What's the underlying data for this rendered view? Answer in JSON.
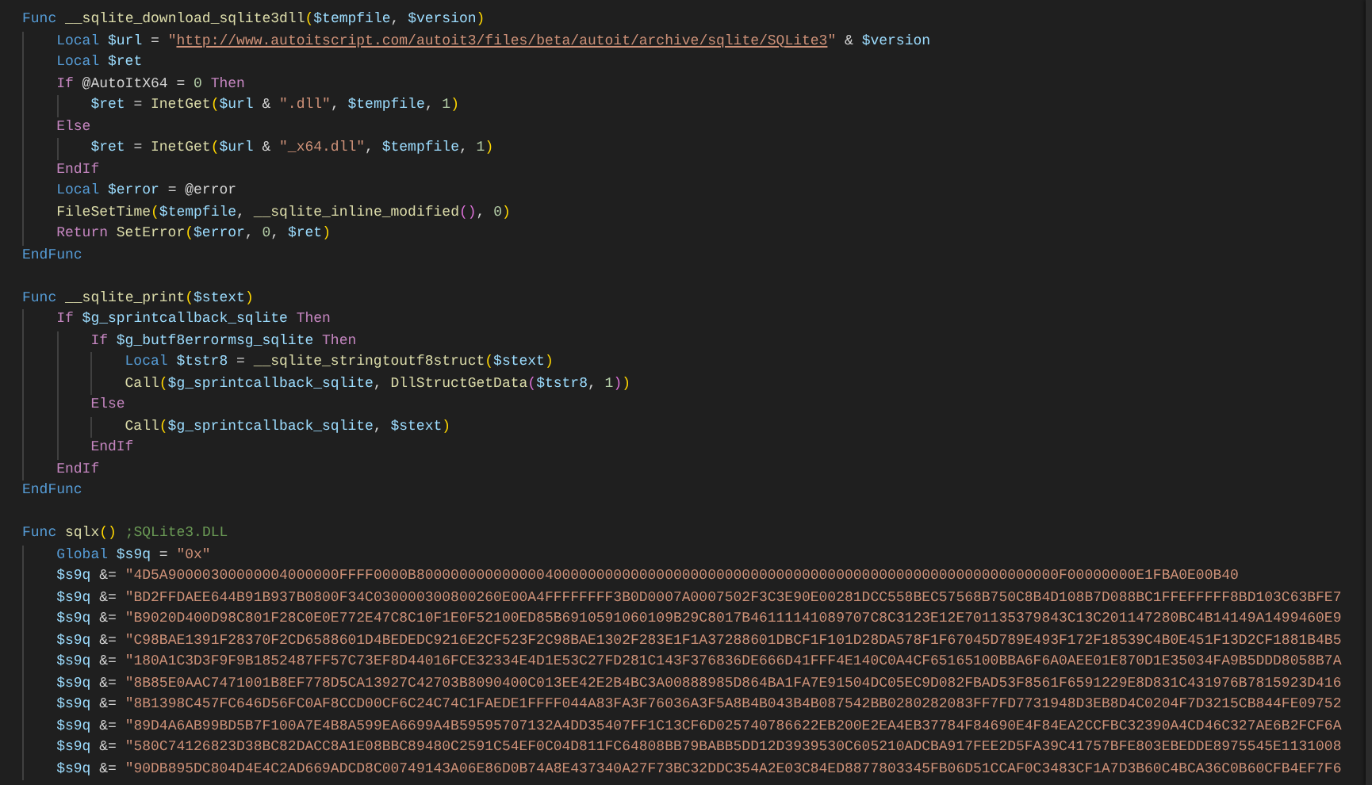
{
  "editor": {
    "lines": [
      {
        "kind": "code",
        "tokens": [
          {
            "kind": "keyword",
            "text": "Func"
          },
          {
            "kind": "function",
            "text": " __sqlite_download_sqlite3dll"
          },
          {
            "kind": "open",
            "text": "("
          },
          {
            "kind": "variable",
            "text": "$tempfile"
          },
          {
            "kind": "operator",
            "text": ", "
          },
          {
            "kind": "variable",
            "text": "$version"
          },
          {
            "kind": "close",
            "text": ")"
          }
        ],
        "children": [
          {
            "tokens": [
              {
                "kind": "keyword",
                "text": "Local"
              },
              {
                "kind": "variable",
                "text": " $url"
              },
              {
                "kind": "operator",
                "text": " = "
              },
              {
                "kind": "string",
                "text": "\""
              },
              {
                "kind": "link",
                "text": "http://www.autoitscript.com/autoit3/files/beta/autoit/archive/sqlite/SQLite3"
              },
              {
                "kind": "string",
                "text": "\""
              },
              {
                "kind": "operator",
                "text": " & "
              },
              {
                "kind": "variable",
                "text": "$version"
              }
            ]
          },
          {
            "tokens": [
              {
                "kind": "keyword",
                "text": "Local"
              },
              {
                "kind": "variable",
                "text": " $ret"
              }
            ]
          },
          {
            "tokens": [
              {
                "kind": "control",
                "text": "If"
              },
              {
                "kind": "macro",
                "text": " @AutoItX64"
              },
              {
                "kind": "operator",
                "text": " = "
              },
              {
                "kind": "number",
                "text": "0"
              },
              {
                "kind": "control",
                "text": " Then"
              }
            ],
            "children": [
              {
                "tokens": [
                  {
                    "kind": "variable",
                    "text": "$ret"
                  },
                  {
                    "kind": "operator",
                    "text": " = "
                  },
                  {
                    "kind": "function",
                    "text": "InetGet"
                  },
                  {
                    "kind": "open",
                    "text": "("
                  },
                  {
                    "kind": "variable",
                    "text": "$url"
                  },
                  {
                    "kind": "operator",
                    "text": " & "
                  },
                  {
                    "kind": "string",
                    "text": "\".dll\""
                  },
                  {
                    "kind": "operator",
                    "text": ", "
                  },
                  {
                    "kind": "variable",
                    "text": "$tempfile"
                  },
                  {
                    "kind": "operator",
                    "text": ", "
                  },
                  {
                    "kind": "number",
                    "text": "1"
                  },
                  {
                    "kind": "close",
                    "text": ")"
                  }
                ]
              }
            ]
          },
          {
            "tokens": [
              {
                "kind": "control",
                "text": "Else"
              }
            ],
            "children": [
              {
                "tokens": [
                  {
                    "kind": "variable",
                    "text": "$ret"
                  },
                  {
                    "kind": "operator",
                    "text": " = "
                  },
                  {
                    "kind": "function",
                    "text": "InetGet"
                  },
                  {
                    "kind": "open",
                    "text": "("
                  },
                  {
                    "kind": "variable",
                    "text": "$url"
                  },
                  {
                    "kind": "operator",
                    "text": " & "
                  },
                  {
                    "kind": "string",
                    "text": "\"_x64.dll\""
                  },
                  {
                    "kind": "operator",
                    "text": ", "
                  },
                  {
                    "kind": "variable",
                    "text": "$tempfile"
                  },
                  {
                    "kind": "operator",
                    "text": ", "
                  },
                  {
                    "kind": "number",
                    "text": "1"
                  },
                  {
                    "kind": "close",
                    "text": ")"
                  }
                ]
              }
            ]
          },
          {
            "tokens": [
              {
                "kind": "control",
                "text": "EndIf"
              }
            ]
          },
          {
            "tokens": [
              {
                "kind": "keyword",
                "text": "Local"
              },
              {
                "kind": "variable",
                "text": " $error"
              },
              {
                "kind": "operator",
                "text": " = "
              },
              {
                "kind": "macro",
                "text": "@error"
              }
            ]
          },
          {
            "tokens": [
              {
                "kind": "function",
                "text": "FileSetTime"
              },
              {
                "kind": "open",
                "text": "("
              },
              {
                "kind": "variable",
                "text": "$tempfile"
              },
              {
                "kind": "operator",
                "text": ", "
              },
              {
                "kind": "function",
                "text": "__sqlite_inline_modified"
              },
              {
                "kind": "open",
                "text": "("
              },
              {
                "kind": "close",
                "text": ")"
              },
              {
                "kind": "operator",
                "text": ", "
              },
              {
                "kind": "number",
                "text": "0"
              },
              {
                "kind": "close",
                "text": ")"
              }
            ]
          },
          {
            "tokens": [
              {
                "kind": "control",
                "text": "Return"
              },
              {
                "kind": "function",
                "text": " SetError"
              },
              {
                "kind": "open",
                "text": "("
              },
              {
                "kind": "variable",
                "text": "$error"
              },
              {
                "kind": "operator",
                "text": ", "
              },
              {
                "kind": "number",
                "text": "0"
              },
              {
                "kind": "operator",
                "text": ", "
              },
              {
                "kind": "variable",
                "text": "$ret"
              },
              {
                "kind": "close",
                "text": ")"
              }
            ]
          }
        ]
      },
      {
        "kind": "code",
        "tokens": [
          {
            "kind": "keyword",
            "text": "EndFunc"
          }
        ]
      },
      {
        "kind": "blank"
      },
      {
        "kind": "code",
        "tokens": [
          {
            "kind": "keyword",
            "text": "Func"
          },
          {
            "kind": "function",
            "text": " __sqlite_print"
          },
          {
            "kind": "open",
            "text": "("
          },
          {
            "kind": "variable",
            "text": "$stext"
          },
          {
            "kind": "close",
            "text": ")"
          }
        ],
        "children": [
          {
            "tokens": [
              {
                "kind": "control",
                "text": "If"
              },
              {
                "kind": "variable",
                "text": " $g_sprintcallback_sqlite"
              },
              {
                "kind": "control",
                "text": " Then"
              }
            ],
            "children": [
              {
                "tokens": [
                  {
                    "kind": "control",
                    "text": "If"
                  },
                  {
                    "kind": "variable",
                    "text": " $g_butf8errormsg_sqlite"
                  },
                  {
                    "kind": "control",
                    "text": " Then"
                  }
                ],
                "children": [
                  {
                    "tokens": [
                      {
                        "kind": "keyword",
                        "text": "Local"
                      },
                      {
                        "kind": "variable",
                        "text": " $tstr8"
                      },
                      {
                        "kind": "operator",
                        "text": " = "
                      },
                      {
                        "kind": "function",
                        "text": "__sqlite_stringtoutf8struct"
                      },
                      {
                        "kind": "open",
                        "text": "("
                      },
                      {
                        "kind": "variable",
                        "text": "$stext"
                      },
                      {
                        "kind": "close",
                        "text": ")"
                      }
                    ]
                  },
                  {
                    "tokens": [
                      {
                        "kind": "function",
                        "text": "Call"
                      },
                      {
                        "kind": "open",
                        "text": "("
                      },
                      {
                        "kind": "variable",
                        "text": "$g_sprintcallback_sqlite"
                      },
                      {
                        "kind": "operator",
                        "text": ", "
                      },
                      {
                        "kind": "function",
                        "text": "DllStructGetData"
                      },
                      {
                        "kind": "open",
                        "text": "("
                      },
                      {
                        "kind": "variable",
                        "text": "$tstr8"
                      },
                      {
                        "kind": "operator",
                        "text": ", "
                      },
                      {
                        "kind": "number",
                        "text": "1"
                      },
                      {
                        "kind": "close",
                        "text": ")"
                      },
                      {
                        "kind": "close",
                        "text": ")"
                      }
                    ]
                  }
                ]
              },
              {
                "tokens": [
                  {
                    "kind": "control",
                    "text": "Else"
                  }
                ],
                "children": [
                  {
                    "tokens": [
                      {
                        "kind": "function",
                        "text": "Call"
                      },
                      {
                        "kind": "open",
                        "text": "("
                      },
                      {
                        "kind": "variable",
                        "text": "$g_sprintcallback_sqlite"
                      },
                      {
                        "kind": "operator",
                        "text": ", "
                      },
                      {
                        "kind": "variable",
                        "text": "$stext"
                      },
                      {
                        "kind": "close",
                        "text": ")"
                      }
                    ]
                  }
                ]
              },
              {
                "tokens": [
                  {
                    "kind": "control",
                    "text": "EndIf"
                  }
                ]
              }
            ]
          },
          {
            "tokens": [
              {
                "kind": "control",
                "text": "EndIf"
              }
            ]
          }
        ]
      },
      {
        "kind": "code",
        "tokens": [
          {
            "kind": "keyword",
            "text": "EndFunc"
          }
        ]
      },
      {
        "kind": "blank"
      },
      {
        "kind": "code",
        "tokens": [
          {
            "kind": "keyword",
            "text": "Func"
          },
          {
            "kind": "function",
            "text": " sqlx"
          },
          {
            "kind": "open",
            "text": "("
          },
          {
            "kind": "close",
            "text": ")"
          },
          {
            "kind": "comment",
            "text": " ;SQLite3.DLL"
          }
        ],
        "children": [
          {
            "tokens": [
              {
                "kind": "keyword",
                "text": "Global"
              },
              {
                "kind": "variable",
                "text": " $s9q"
              },
              {
                "kind": "operator",
                "text": " = "
              },
              {
                "kind": "string",
                "text": "\"0x\""
              }
            ]
          },
          {
            "tokens": [
              {
                "kind": "variable",
                "text": "$s9q"
              },
              {
                "kind": "operator",
                "text": " &= "
              },
              {
                "kind": "string",
                "text": "\"4D5A90000300000004000000FFFF0000B800000000000000400000000000000000000000000000000000000000000000000000000000F00000000E1FBA0E00B40"
              }
            ]
          },
          {
            "tokens": [
              {
                "kind": "variable",
                "text": "$s9q"
              },
              {
                "kind": "operator",
                "text": " &= "
              },
              {
                "kind": "string",
                "text": "\"BD2FFDAEE644B91B937B0800F34C030000300800260E00A4FFFFFFFF3B0D0007A0007502F3C3E90E00281DCC558BEC57568B750C8B4D108B7D088BC1FFEFFFFF8BD103C63BFE7"
              }
            ]
          },
          {
            "tokens": [
              {
                "kind": "variable",
                "text": "$s9q"
              },
              {
                "kind": "operator",
                "text": " &= "
              },
              {
                "kind": "string",
                "text": "\"B9020D400D98C801F28C0E0E772E47C8C10F1E0F52100ED85B6910591060109B29C8017B46111141089707C8C3123E12E701135379843C13C201147280BC4B14149A1499460E9"
              }
            ]
          },
          {
            "tokens": [
              {
                "kind": "variable",
                "text": "$s9q"
              },
              {
                "kind": "operator",
                "text": " &= "
              },
              {
                "kind": "string",
                "text": "\"C98BAE1391F28370F2CD6588601D4BEDEDC9216E2CF523F2C98BAE1302F283E1F1A37288601DBCF1F101D28DA578F1F67045D789E493F172F18539C4B0E451F13D2CF1881B4B5"
              }
            ]
          },
          {
            "tokens": [
              {
                "kind": "variable",
                "text": "$s9q"
              },
              {
                "kind": "operator",
                "text": " &= "
              },
              {
                "kind": "string",
                "text": "\"180A1C3D3F9F9B1852487FF57C73EF8D44016FCE32334E4D1E53C27FD281C143F376836DE666D41FFF4E140C0A4CF65165100BBA6F6A0AEE01E870D1E35034FA9B5DDD8058B7A"
              }
            ]
          },
          {
            "tokens": [
              {
                "kind": "variable",
                "text": "$s9q"
              },
              {
                "kind": "operator",
                "text": " &= "
              },
              {
                "kind": "string",
                "text": "\"8B85E0AAC7471001B8EF778D5CA13927C42703B8090400C013EE42E2B4BC3A00888985D864BA1FA7E91504DC05EC9D082FBAD53F8561F6591229E8D831C431976B7815923D416"
              }
            ]
          },
          {
            "tokens": [
              {
                "kind": "variable",
                "text": "$s9q"
              },
              {
                "kind": "operator",
                "text": " &= "
              },
              {
                "kind": "string",
                "text": "\"8B1398C457FC646D56FC0AF8CCD00CF6C24C74C1FAEDE1FFFF044A83FA3F76036A3F5A8B4B043B4B087542BB0280282083FF7FD7731948D3EB8D4C0204F7D3215CB844FE09752"
              }
            ]
          },
          {
            "tokens": [
              {
                "kind": "variable",
                "text": "$s9q"
              },
              {
                "kind": "operator",
                "text": " &= "
              },
              {
                "kind": "string",
                "text": "\"89D4A6AB99BD5B7F100A7E4B8A599EA6699A4B59595707132A4DD35407FF1C13CF6D025740786622EB200E2EA4EB37784F84690E4F84EA2CCFBC32390A4CD46C327AE6B2FCF6A"
              }
            ]
          },
          {
            "tokens": [
              {
                "kind": "variable",
                "text": "$s9q"
              },
              {
                "kind": "operator",
                "text": " &= "
              },
              {
                "kind": "string",
                "text": "\"580C74126823D38BC82DACC8A1E08BBC89480C2591C54EF0C04D811FC64808BB79BABB5DD12D3939530C605210ADCBA917FEE2D5FA39C41757BFE803EBEDDE8975545E1131008"
              }
            ]
          },
          {
            "tokens": [
              {
                "kind": "variable",
                "text": "$s9q"
              },
              {
                "kind": "operator",
                "text": " &= "
              },
              {
                "kind": "string",
                "text": "\"90DB895DC804D4E4C2AD669ADCD8C00749143A06E86D0B74A8E437340A27F73BC32DDC354A2E03C84ED8877803345FB06D51CCAF0C3483CF1A7D3B60C4BCA36C0B60CFB4EF7F6"
              }
            ]
          }
        ]
      }
    ]
  }
}
